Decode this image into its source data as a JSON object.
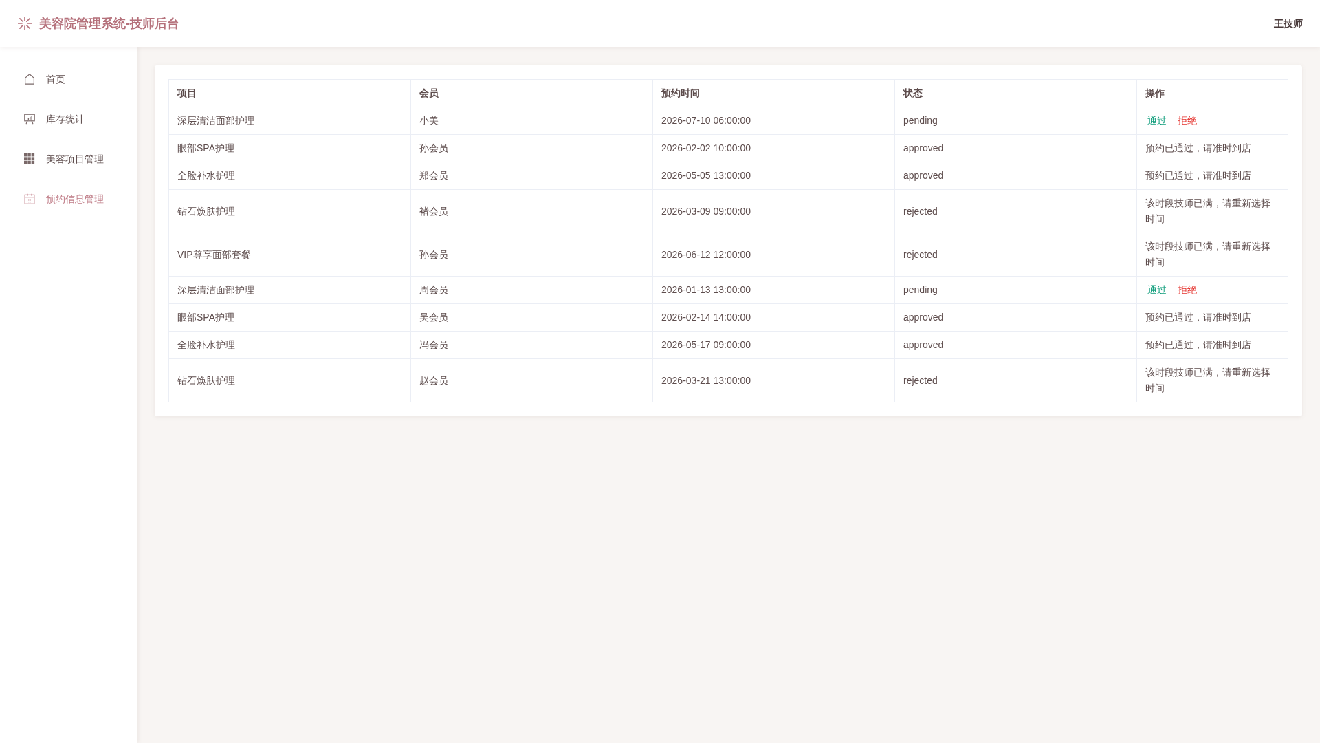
{
  "header": {
    "title": "美容院管理系统-技师后台",
    "user": "王技师"
  },
  "sidebar": {
    "items": [
      {
        "label": "首页",
        "kind": "home",
        "selected": false
      },
      {
        "label": "库存统计",
        "kind": "chart",
        "selected": false
      },
      {
        "label": "美容项目管理",
        "kind": "grid",
        "selected": false
      },
      {
        "label": "预约信息管理",
        "kind": "calendar",
        "selected": true
      }
    ]
  },
  "table": {
    "columns": [
      "项目",
      "会员",
      "预约时间",
      "状态",
      "操作"
    ],
    "rows": [
      {
        "project": "深层清洁面部护理",
        "member": "小美",
        "time": "2026-07-10 06:00:00",
        "status": "pending",
        "action": {
          "kind": "buttons",
          "buttons": [
            {
              "label": "通过",
              "kind": "approve"
            },
            {
              "label": "拒绝",
              "kind": "reject"
            }
          ]
        }
      },
      {
        "project": "眼部SPA护理",
        "member": "孙会员",
        "time": "2026-02-02 10:00:00",
        "status": "approved",
        "action": {
          "kind": "note",
          "text": "预约已通过，请准时到店"
        }
      },
      {
        "project": "全脸补水护理",
        "member": "郑会员",
        "time": "2026-05-05 13:00:00",
        "status": "approved",
        "action": {
          "kind": "note",
          "text": "预约已通过，请准时到店"
        }
      },
      {
        "project": "钻石焕肤护理",
        "member": "褚会员",
        "time": "2026-03-09 09:00:00",
        "status": "rejected",
        "action": {
          "kind": "note",
          "text": "该时段技师已满，请重新选择时间"
        }
      },
      {
        "project": "VIP尊享面部套餐",
        "member": "孙会员",
        "time": "2026-06-12 12:00:00",
        "status": "rejected",
        "action": {
          "kind": "note",
          "text": "该时段技师已满，请重新选择时间"
        }
      },
      {
        "project": "深层清洁面部护理",
        "member": "周会员",
        "time": "2026-01-13 13:00:00",
        "status": "pending",
        "action": {
          "kind": "buttons",
          "buttons": [
            {
              "label": "通过",
              "kind": "approve"
            },
            {
              "label": "拒绝",
              "kind": "reject"
            }
          ]
        }
      },
      {
        "project": "眼部SPA护理",
        "member": "吴会员",
        "time": "2026-02-14 14:00:00",
        "status": "approved",
        "action": {
          "kind": "note",
          "text": "预约已通过，请准时到店"
        }
      },
      {
        "project": "全脸补水护理",
        "member": "冯会员",
        "time": "2026-05-17 09:00:00",
        "status": "approved",
        "action": {
          "kind": "note",
          "text": "预约已通过，请准时到店"
        }
      },
      {
        "project": "钻石焕肤护理",
        "member": "赵会员",
        "time": "2026-03-21 13:00:00",
        "status": "rejected",
        "action": {
          "kind": "note",
          "text": "该时段技师已满，请重新选择时间"
        }
      }
    ]
  }
}
